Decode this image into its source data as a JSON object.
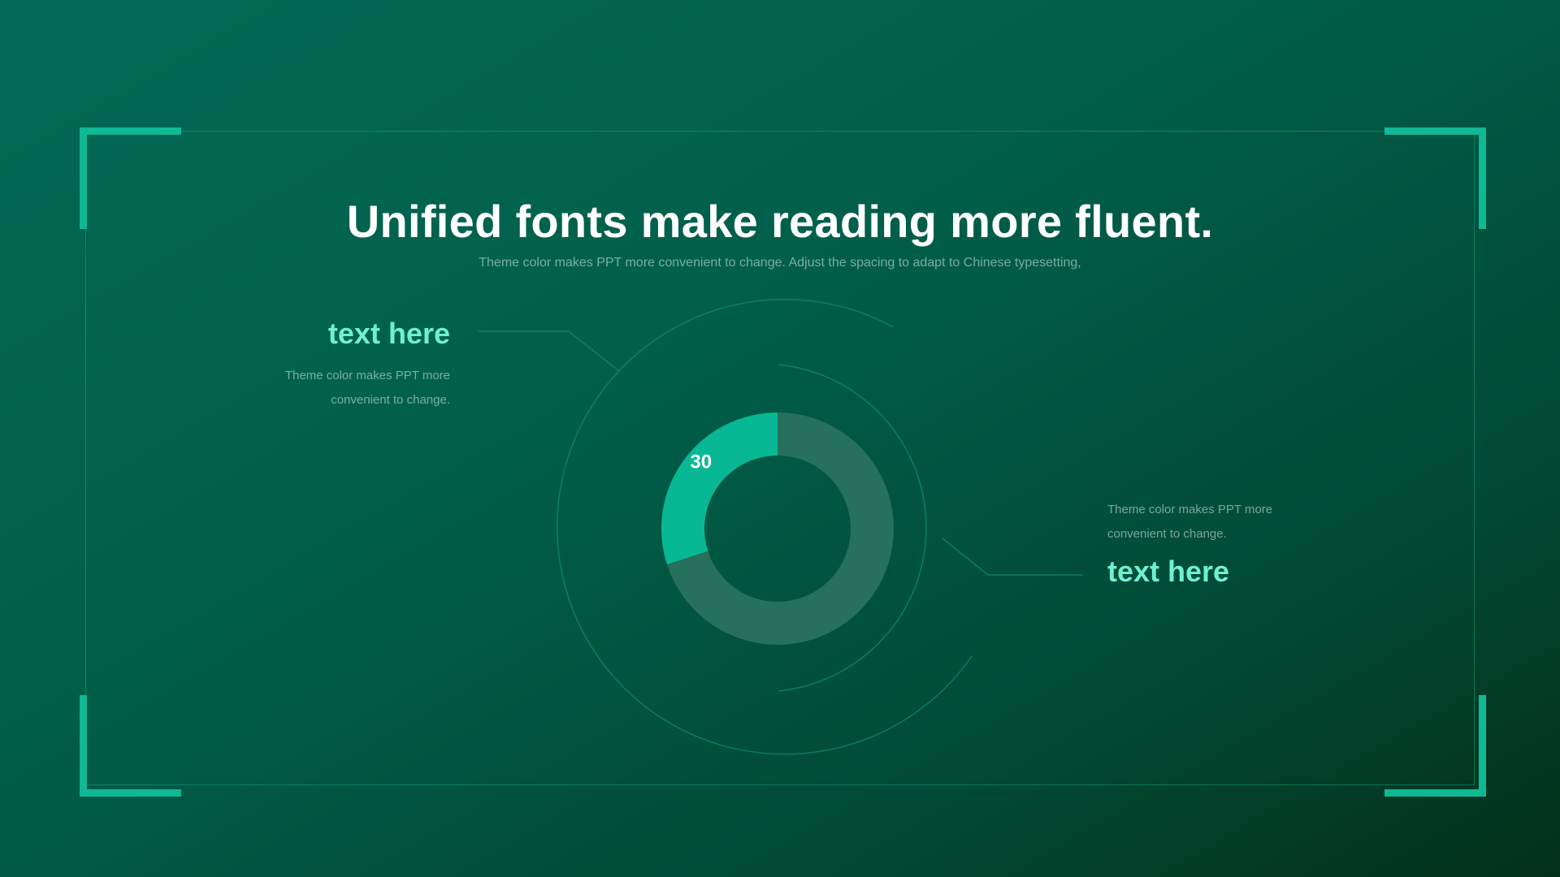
{
  "header": {
    "title": "Unified fonts make reading more fluent.",
    "subtitle": "Theme color makes PPT more convenient to change. Adjust the spacing to adapt to Chinese typesetting,"
  },
  "callouts": {
    "left": {
      "title": "text here",
      "desc_line1": "Theme color makes PPT more",
      "desc_line2": "convenient to change."
    },
    "right": {
      "title": "text here",
      "desc_line1": "Theme color makes PPT more",
      "desc_line2": "convenient to change."
    }
  },
  "colors": {
    "accent": "#10b894",
    "highlight_text": "#6ff0d2",
    "ring_rest": "#27705d",
    "line": "#128e70"
  },
  "chart_data": {
    "type": "pie",
    "variant": "donut",
    "values": [
      30,
      70
    ],
    "data_labels": [
      "30",
      ""
    ],
    "colors": [
      "#08b894",
      "#27705d"
    ],
    "title": ""
  }
}
